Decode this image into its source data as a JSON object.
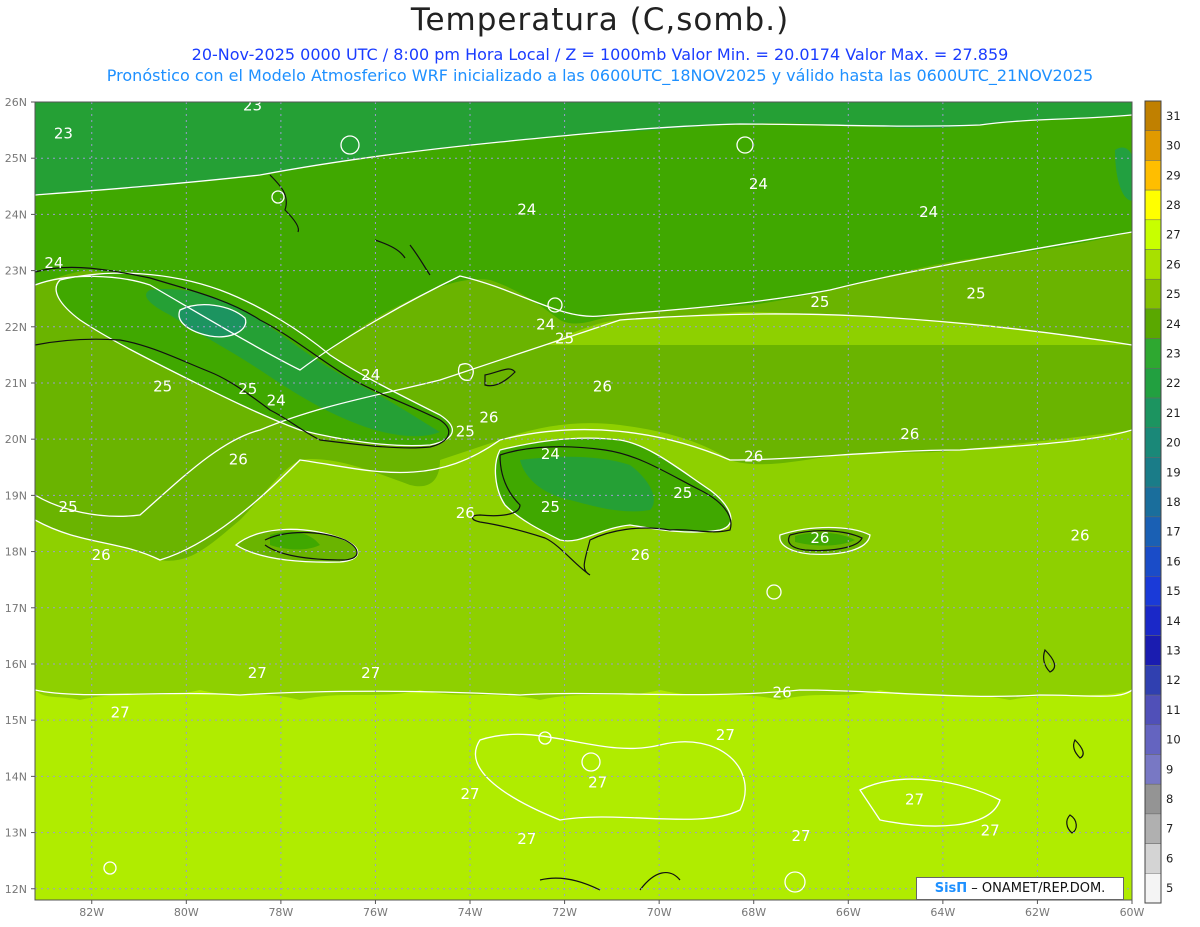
{
  "header": {
    "title": "Temperatura (C,somb.)",
    "line1": "20-Nov-2025  0000 UTC / 8:00 pm Hora Local / Z = 1000mb    Valor Min. = 20.0174  Valor Max. = 27.859",
    "line2": "Pronóstico con el Modelo Atmosferico WRF inicializado a las 0600UTC_18NOV2025 y válido hasta las  0600UTC_21NOV2025"
  },
  "axes": {
    "lat_labels": [
      "26N",
      "25N",
      "24N",
      "23N",
      "22N",
      "21N",
      "20N",
      "19N",
      "18N",
      "17N",
      "16N",
      "15N",
      "14N",
      "13N",
      "12N"
    ],
    "lon_labels": [
      "82W",
      "80W",
      "78W",
      "76W",
      "74W",
      "72W",
      "70W",
      "68W",
      "66W",
      "64W",
      "62W",
      "60W"
    ]
  },
  "colorbar": {
    "levels": [
      "31",
      "30",
      "29",
      "28",
      "27",
      "26",
      "25",
      "24",
      "23",
      "22",
      "21",
      "20",
      "19",
      "18",
      "17",
      "16",
      "15",
      "14",
      "13",
      "12",
      "11",
      "10",
      "9",
      "8",
      "7",
      "6",
      "5"
    ],
    "colors": [
      "#c08000",
      "#e09a00",
      "#ffbe00",
      "#ffff00",
      "#c8ff00",
      "#a8e000",
      "#84c000",
      "#5aa800",
      "#2ea830",
      "#22a040",
      "#1c9460",
      "#1a8878",
      "#1a7c88",
      "#1a6e9c",
      "#1a60b4",
      "#1a4cc8",
      "#1a3ad8",
      "#1a28c8",
      "#1a1cb0",
      "#3040b0",
      "#5050b8",
      "#6464c0",
      "#7878c4",
      "#949494",
      "#b0b0b0",
      "#d4d4d4",
      "#f4f4f4"
    ]
  },
  "contour_labels": [
    {
      "t": "23",
      "lat": 25.35,
      "lon": -82.6
    },
    {
      "t": "23",
      "lat": 25.85,
      "lon": -78.6
    },
    {
      "t": "24",
      "lat": 24.45,
      "lon": -67.9
    },
    {
      "t": "24",
      "lat": 23.95,
      "lon": -64.3
    },
    {
      "t": "24",
      "lat": 24.0,
      "lon": -72.8
    },
    {
      "t": "24",
      "lat": 23.05,
      "lon": -82.8
    },
    {
      "t": "25",
      "lat": 22.35,
      "lon": -66.6
    },
    {
      "t": "25",
      "lat": 22.5,
      "lon": -63.3
    },
    {
      "t": "24",
      "lat": 21.95,
      "lon": -72.4
    },
    {
      "t": "25",
      "lat": 21.7,
      "lon": -72.0
    },
    {
      "t": "24",
      "lat": 21.05,
      "lon": -76.1
    },
    {
      "t": "25",
      "lat": 20.85,
      "lon": -80.5
    },
    {
      "t": "25",
      "lat": 20.8,
      "lon": -78.7
    },
    {
      "t": "24",
      "lat": 20.6,
      "lon": -78.1
    },
    {
      "t": "26",
      "lat": 20.85,
      "lon": -71.2
    },
    {
      "t": "26",
      "lat": 20.3,
      "lon": -73.6
    },
    {
      "t": "25",
      "lat": 20.05,
      "lon": -74.1
    },
    {
      "t": "26",
      "lat": 20.0,
      "lon": -64.7
    },
    {
      "t": "24",
      "lat": 19.65,
      "lon": -72.3
    },
    {
      "t": "26",
      "lat": 19.6,
      "lon": -68.0
    },
    {
      "t": "26",
      "lat": 19.55,
      "lon": -78.9
    },
    {
      "t": "25",
      "lat": 18.95,
      "lon": -69.5
    },
    {
      "t": "25",
      "lat": 18.7,
      "lon": -82.5
    },
    {
      "t": "25",
      "lat": 18.7,
      "lon": -72.3
    },
    {
      "t": "26",
      "lat": 18.6,
      "lon": -74.1
    },
    {
      "t": "26",
      "lat": 18.15,
      "lon": -66.6
    },
    {
      "t": "26",
      "lat": 18.2,
      "lon": -61.1
    },
    {
      "t": "26",
      "lat": 17.85,
      "lon": -81.8
    },
    {
      "t": "26",
      "lat": 17.85,
      "lon": -70.4
    },
    {
      "t": "27",
      "lat": 15.75,
      "lon": -78.5
    },
    {
      "t": "27",
      "lat": 15.75,
      "lon": -76.1
    },
    {
      "t": "26",
      "lat": 15.4,
      "lon": -67.4
    },
    {
      "t": "27",
      "lat": 15.05,
      "lon": -81.4
    },
    {
      "t": "27",
      "lat": 14.65,
      "lon": -68.6
    },
    {
      "t": "27",
      "lat": 13.8,
      "lon": -71.3
    },
    {
      "t": "27",
      "lat": 13.6,
      "lon": -74.0
    },
    {
      "t": "27",
      "lat": 13.5,
      "lon": -64.6
    },
    {
      "t": "27",
      "lat": 12.95,
      "lon": -63.0
    },
    {
      "t": "27",
      "lat": 12.8,
      "lon": -72.8
    },
    {
      "t": "27",
      "lat": 12.85,
      "lon": -67.0
    }
  ],
  "credit": {
    "brand": "SisΠ",
    "text": " – ONAMET/REP.DOM."
  }
}
